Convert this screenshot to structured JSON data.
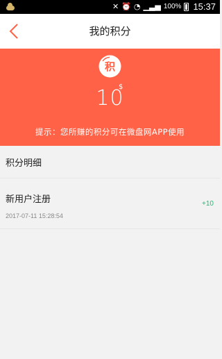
{
  "status_bar": {
    "battery_percent": "100%",
    "time": "15:37"
  },
  "header": {
    "title": "我的积分"
  },
  "banner": {
    "badge_char": "积",
    "points": "10",
    "unit": "$",
    "tip": "提示：您所赚的积分可在微盘网APP使用",
    "background_color": "#ff6246"
  },
  "section": {
    "title": "积分明细"
  },
  "records": [
    {
      "title": "新用户注册",
      "time": "2017-07-11 15:28:54",
      "points": "+10",
      "points_color": "#2bb573"
    }
  ]
}
